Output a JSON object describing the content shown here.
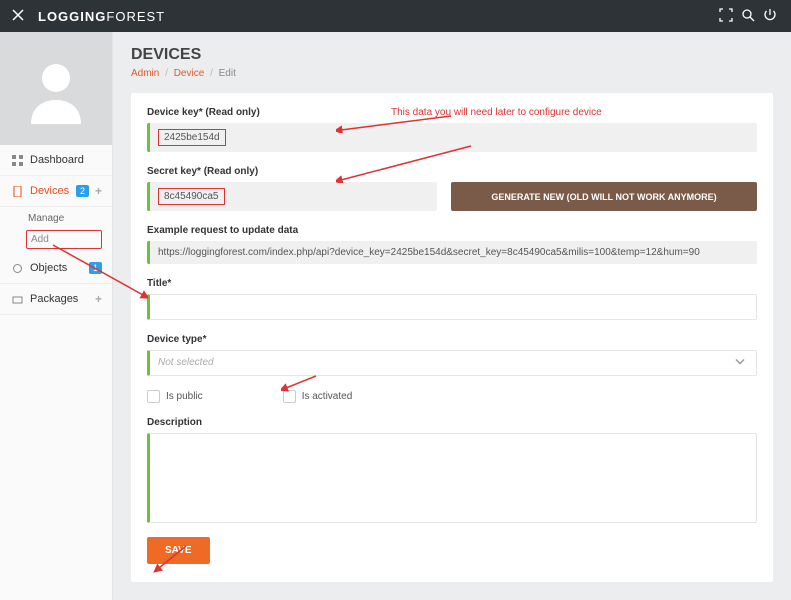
{
  "header": {
    "brand_bold": "LOGGING",
    "brand_light": "FOREST"
  },
  "sidebar": {
    "items": [
      {
        "label": "Dashboard"
      },
      {
        "label": "Devices",
        "badge": "2",
        "sub": [
          "Manage",
          "Add"
        ]
      },
      {
        "label": "Objects",
        "badge": "1"
      },
      {
        "label": "Packages"
      }
    ]
  },
  "page": {
    "title": "DEVICES",
    "crumb_admin": "Admin",
    "crumb_device": "Device",
    "crumb_edit": "Edit"
  },
  "form": {
    "device_key_label": "Device key* (Read only)",
    "device_key_value": "2425be154d",
    "hint": "This data you will need later to configure device",
    "secret_key_label": "Secret key* (Read only)",
    "secret_key_value": "8c45490ca5",
    "generate_btn": "GENERATE NEW (OLD WILL NOT WORK ANYMORE)",
    "example_label": "Example request to update data",
    "example_value": "https://loggingforest.com/index.php/api?device_key=2425be154d&secret_key=8c45490ca5&milis=100&temp=12&hum=90",
    "title_label": "Title*",
    "title_value": "",
    "type_label": "Device type*",
    "type_value": "Not selected",
    "chk_public": "Is public",
    "chk_activated": "Is activated",
    "desc_label": "Description",
    "desc_value": "",
    "save": "SAVE"
  }
}
